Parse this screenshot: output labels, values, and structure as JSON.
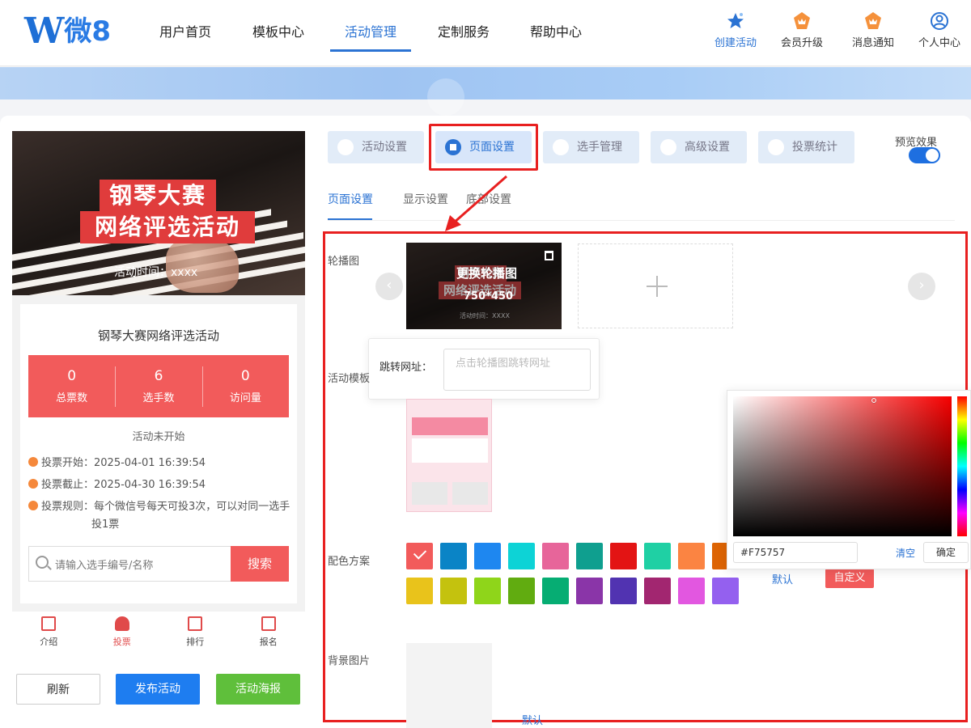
{
  "logo": {
    "mark": "W",
    "text": "微8"
  },
  "nav": {
    "items": [
      {
        "label": "用户首页"
      },
      {
        "label": "模板中心"
      },
      {
        "label": "活动管理",
        "active": true
      },
      {
        "label": "定制服务"
      },
      {
        "label": "帮助中心"
      }
    ],
    "right": [
      {
        "label": "创建活动",
        "icon": "star-icon"
      },
      {
        "label": "会员升级",
        "icon": "crown-icon"
      },
      {
        "label": "消息通知",
        "icon": "bell-icon"
      },
      {
        "label": "个人中心",
        "icon": "user-icon"
      }
    ]
  },
  "preview": {
    "hero": {
      "line1": "钢琴大赛",
      "line2": "网络评选活动",
      "time": "活动时间：xxxx"
    },
    "title": "钢琴大赛网络评选活动",
    "stats": [
      {
        "value": "0",
        "label": "总票数"
      },
      {
        "value": "6",
        "label": "选手数"
      },
      {
        "value": "0",
        "label": "访问量"
      }
    ],
    "status": "活动未开始",
    "vote_start": "投票开始：2025-04-01 16:39:54",
    "vote_end": "投票截止：2025-04-30 16:39:54",
    "vote_rule_1": "投票规则：每个微信号每天可投3次，可以对同一选手",
    "vote_rule_2": "投1票",
    "search_placeholder": "请输入选手编号/名称",
    "search_button": "搜索",
    "tabbar": [
      "介绍",
      "投票",
      "排行",
      "报名"
    ]
  },
  "left_buttons": {
    "refresh": "刷新",
    "publish": "发布活动",
    "poster": "活动海报"
  },
  "main_tabs": [
    "活动设置",
    "页面设置",
    "选手管理",
    "高级设置",
    "投票统计"
  ],
  "preview_toggle": {
    "label": "预览效果",
    "on": true
  },
  "sub_tabs": [
    "页面设置",
    "显示设置",
    "底部设置"
  ],
  "form": {
    "carousel_label": "轮播图",
    "carousel_overlay_title": "更换轮播图",
    "carousel_overlay_size": "750*450",
    "carousel_thumb_line1": "钢琴大赛",
    "carousel_thumb_line2": "网络评选活动",
    "carousel_thumb_time": "活动时间：XXXX",
    "jump_label": "跳转网址：",
    "jump_placeholder": "点击轮播图跳转网址",
    "template_label": "活动模板",
    "color_label": "配色方案",
    "colors": [
      "#f25b5b",
      "#0a84c6",
      "#1e87f0",
      "#0dd3d6",
      "#e7659a",
      "#0f9f8f",
      "#e31414",
      "#1fd0a4",
      "#fb8442",
      "#dd6404",
      "#e9c31b",
      "#c4c20e",
      "#8fd51a",
      "#61ac10",
      "#06ad73",
      "#8a35a8",
      "#5133b1",
      "#a22670",
      "#e257e0",
      "#9460ef"
    ],
    "selected_color_index": 0,
    "color_default": "默认",
    "color_custom": "自定义",
    "bg_label": "背景图片",
    "bg_default": "默认"
  },
  "picker": {
    "hex": "#F75757",
    "clear": "清空",
    "ok": "确定"
  }
}
